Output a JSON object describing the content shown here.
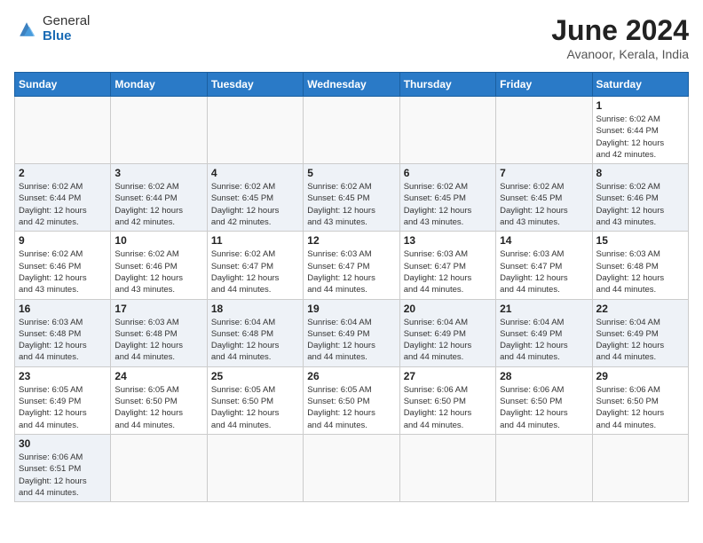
{
  "header": {
    "logo_general": "General",
    "logo_blue": "Blue",
    "month_year": "June 2024",
    "location": "Avanoor, Kerala, India"
  },
  "days_of_week": [
    "Sunday",
    "Monday",
    "Tuesday",
    "Wednesday",
    "Thursday",
    "Friday",
    "Saturday"
  ],
  "weeks": [
    [
      {
        "day": "",
        "info": ""
      },
      {
        "day": "",
        "info": ""
      },
      {
        "day": "",
        "info": ""
      },
      {
        "day": "",
        "info": ""
      },
      {
        "day": "",
        "info": ""
      },
      {
        "day": "",
        "info": ""
      },
      {
        "day": "1",
        "info": "Sunrise: 6:02 AM\nSunset: 6:44 PM\nDaylight: 12 hours\nand 42 minutes."
      }
    ],
    [
      {
        "day": "2",
        "info": "Sunrise: 6:02 AM\nSunset: 6:44 PM\nDaylight: 12 hours\nand 42 minutes."
      },
      {
        "day": "3",
        "info": "Sunrise: 6:02 AM\nSunset: 6:44 PM\nDaylight: 12 hours\nand 42 minutes."
      },
      {
        "day": "4",
        "info": "Sunrise: 6:02 AM\nSunset: 6:45 PM\nDaylight: 12 hours\nand 42 minutes."
      },
      {
        "day": "5",
        "info": "Sunrise: 6:02 AM\nSunset: 6:45 PM\nDaylight: 12 hours\nand 43 minutes."
      },
      {
        "day": "6",
        "info": "Sunrise: 6:02 AM\nSunset: 6:45 PM\nDaylight: 12 hours\nand 43 minutes."
      },
      {
        "day": "7",
        "info": "Sunrise: 6:02 AM\nSunset: 6:45 PM\nDaylight: 12 hours\nand 43 minutes."
      },
      {
        "day": "8",
        "info": "Sunrise: 6:02 AM\nSunset: 6:46 PM\nDaylight: 12 hours\nand 43 minutes."
      }
    ],
    [
      {
        "day": "9",
        "info": "Sunrise: 6:02 AM\nSunset: 6:46 PM\nDaylight: 12 hours\nand 43 minutes."
      },
      {
        "day": "10",
        "info": "Sunrise: 6:02 AM\nSunset: 6:46 PM\nDaylight: 12 hours\nand 43 minutes."
      },
      {
        "day": "11",
        "info": "Sunrise: 6:02 AM\nSunset: 6:47 PM\nDaylight: 12 hours\nand 44 minutes."
      },
      {
        "day": "12",
        "info": "Sunrise: 6:03 AM\nSunset: 6:47 PM\nDaylight: 12 hours\nand 44 minutes."
      },
      {
        "day": "13",
        "info": "Sunrise: 6:03 AM\nSunset: 6:47 PM\nDaylight: 12 hours\nand 44 minutes."
      },
      {
        "day": "14",
        "info": "Sunrise: 6:03 AM\nSunset: 6:47 PM\nDaylight: 12 hours\nand 44 minutes."
      },
      {
        "day": "15",
        "info": "Sunrise: 6:03 AM\nSunset: 6:48 PM\nDaylight: 12 hours\nand 44 minutes."
      }
    ],
    [
      {
        "day": "16",
        "info": "Sunrise: 6:03 AM\nSunset: 6:48 PM\nDaylight: 12 hours\nand 44 minutes."
      },
      {
        "day": "17",
        "info": "Sunrise: 6:03 AM\nSunset: 6:48 PM\nDaylight: 12 hours\nand 44 minutes."
      },
      {
        "day": "18",
        "info": "Sunrise: 6:04 AM\nSunset: 6:48 PM\nDaylight: 12 hours\nand 44 minutes."
      },
      {
        "day": "19",
        "info": "Sunrise: 6:04 AM\nSunset: 6:49 PM\nDaylight: 12 hours\nand 44 minutes."
      },
      {
        "day": "20",
        "info": "Sunrise: 6:04 AM\nSunset: 6:49 PM\nDaylight: 12 hours\nand 44 minutes."
      },
      {
        "day": "21",
        "info": "Sunrise: 6:04 AM\nSunset: 6:49 PM\nDaylight: 12 hours\nand 44 minutes."
      },
      {
        "day": "22",
        "info": "Sunrise: 6:04 AM\nSunset: 6:49 PM\nDaylight: 12 hours\nand 44 minutes."
      }
    ],
    [
      {
        "day": "23",
        "info": "Sunrise: 6:05 AM\nSunset: 6:49 PM\nDaylight: 12 hours\nand 44 minutes."
      },
      {
        "day": "24",
        "info": "Sunrise: 6:05 AM\nSunset: 6:50 PM\nDaylight: 12 hours\nand 44 minutes."
      },
      {
        "day": "25",
        "info": "Sunrise: 6:05 AM\nSunset: 6:50 PM\nDaylight: 12 hours\nand 44 minutes."
      },
      {
        "day": "26",
        "info": "Sunrise: 6:05 AM\nSunset: 6:50 PM\nDaylight: 12 hours\nand 44 minutes."
      },
      {
        "day": "27",
        "info": "Sunrise: 6:06 AM\nSunset: 6:50 PM\nDaylight: 12 hours\nand 44 minutes."
      },
      {
        "day": "28",
        "info": "Sunrise: 6:06 AM\nSunset: 6:50 PM\nDaylight: 12 hours\nand 44 minutes."
      },
      {
        "day": "29",
        "info": "Sunrise: 6:06 AM\nSunset: 6:50 PM\nDaylight: 12 hours\nand 44 minutes."
      }
    ],
    [
      {
        "day": "30",
        "info": "Sunrise: 6:06 AM\nSunset: 6:51 PM\nDaylight: 12 hours\nand 44 minutes."
      },
      {
        "day": "",
        "info": ""
      },
      {
        "day": "",
        "info": ""
      },
      {
        "day": "",
        "info": ""
      },
      {
        "day": "",
        "info": ""
      },
      {
        "day": "",
        "info": ""
      },
      {
        "day": "",
        "info": ""
      }
    ]
  ]
}
